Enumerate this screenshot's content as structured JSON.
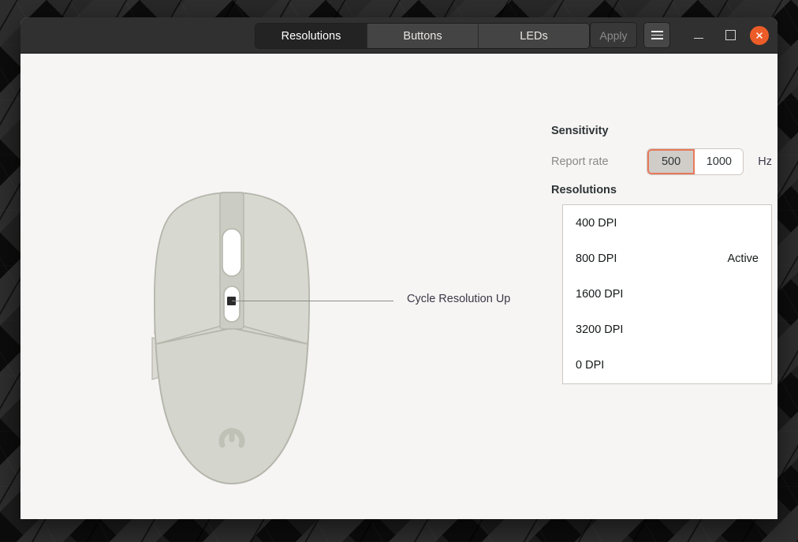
{
  "window": {
    "tabs": [
      {
        "label": "Resolutions",
        "active": true
      },
      {
        "label": "Buttons",
        "active": false
      },
      {
        "label": "LEDs",
        "active": false
      }
    ],
    "apply_label": "Apply",
    "menu_icon": "hamburger-menu-icon",
    "minimize_icon": "minimize-icon",
    "maximize_icon": "maximize-icon",
    "close_icon": "close-icon"
  },
  "illustration": {
    "device": "gaming-mouse-top-view",
    "callout_label": "Cycle Resolution Up",
    "logo": "mouse-brand-logo"
  },
  "settings": {
    "sensitivity": {
      "title": "Sensitivity",
      "report_rate_label": "Report rate",
      "options": [
        {
          "value": "500",
          "selected": true
        },
        {
          "value": "1000",
          "selected": false
        }
      ],
      "unit": "Hz"
    },
    "resolutions": {
      "title": "Resolutions",
      "items": [
        {
          "name": "400 DPI",
          "state": ""
        },
        {
          "name": "800 DPI",
          "state": "Active"
        },
        {
          "name": "1600 DPI",
          "state": ""
        },
        {
          "name": "3200 DPI",
          "state": ""
        },
        {
          "name": "0 DPI",
          "state": ""
        }
      ]
    }
  },
  "colors": {
    "accent": "#e8795a",
    "close_button": "#ec5c28",
    "headerbar": "#303030",
    "content_bg": "#f6f5f4"
  }
}
